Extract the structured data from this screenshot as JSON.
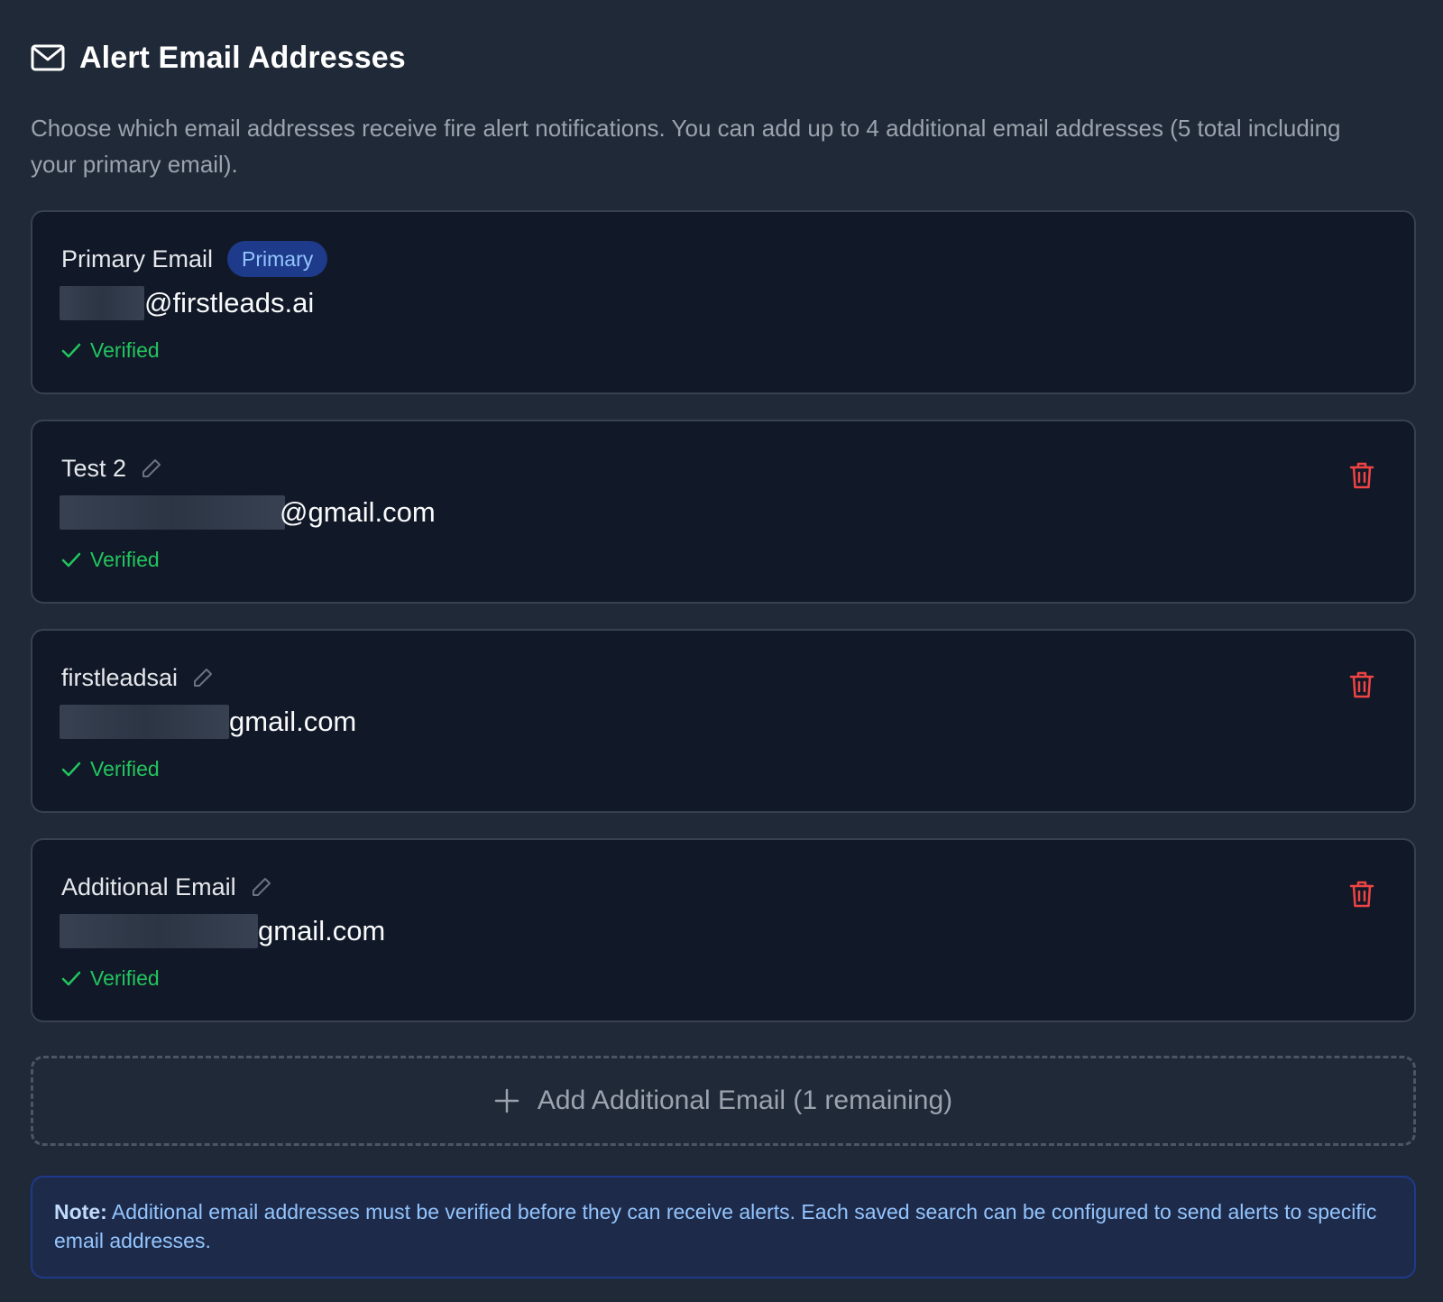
{
  "header": {
    "icon": "mail-icon",
    "title": "Alert Email Addresses",
    "description": "Choose which email addresses receive fire alert notifications. You can add up to 4 additional email addresses (5 total including your primary email)."
  },
  "colors": {
    "background": "#1f2937",
    "card": "#111827",
    "verified": "#22c55e",
    "delete": "#ef4444",
    "badge_bg": "#1e3a8a",
    "badge_text": "#93c5fd"
  },
  "emails": [
    {
      "label": "Primary Email",
      "badge": "Primary",
      "domain": "@firstleads.ai",
      "status": "Verified",
      "editable": false,
      "deletable": false
    },
    {
      "label": "Test 2",
      "domain": "@gmail.com",
      "status": "Verified",
      "editable": true,
      "deletable": true
    },
    {
      "label": "firstleadsai",
      "domain": "gmail.com",
      "status": "Verified",
      "editable": true,
      "deletable": true
    },
    {
      "label": "Additional Email",
      "domain": "gmail.com",
      "status": "Verified",
      "editable": true,
      "deletable": true
    }
  ],
  "add_button": {
    "icon": "plus-icon",
    "label": "Add Additional Email (1 remaining)"
  },
  "note": {
    "prefix": "Note:",
    "text": " Additional email addresses must be verified before they can receive alerts. Each saved search can be configured to send alerts to specific email addresses."
  }
}
